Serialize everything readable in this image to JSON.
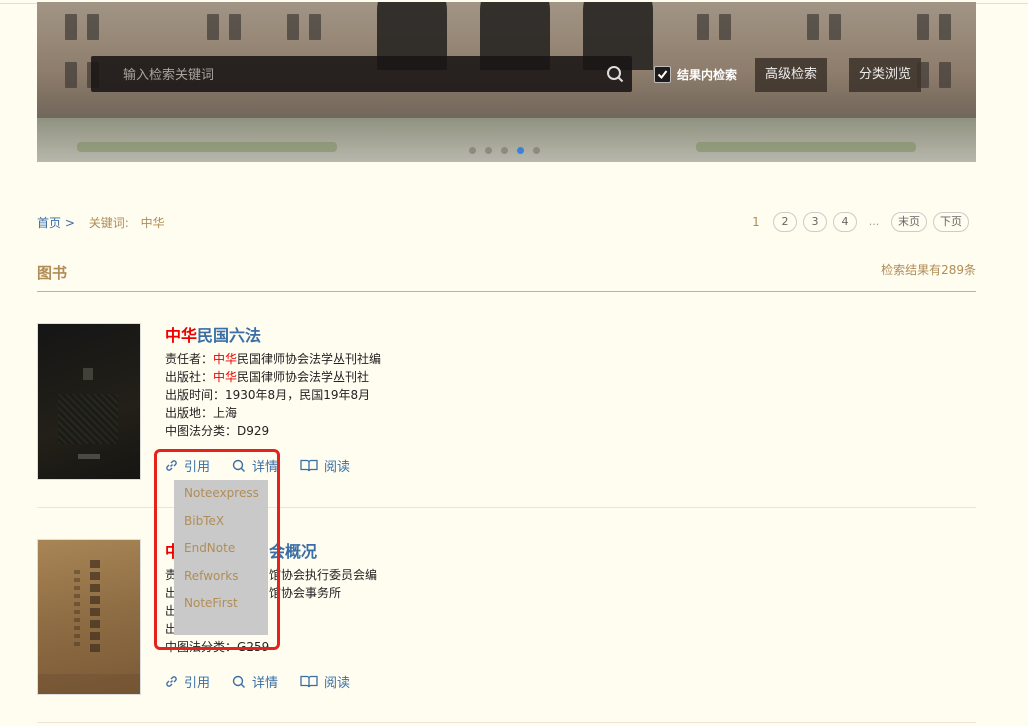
{
  "search": {
    "placeholder": "输入检索关键词",
    "within_results_label": "结果内检索",
    "within_results_checked": true,
    "advanced_label": "高级检索",
    "browse_label": "分类浏览"
  },
  "carousel": {
    "count": 5,
    "active": 3
  },
  "breadcrumb": {
    "home": "首页 >",
    "keyword_label": "关键词:",
    "keyword": "中华"
  },
  "pagination": {
    "current": "1",
    "pages": [
      "2",
      "3",
      "4"
    ],
    "ellipsis": "...",
    "last": "末页",
    "next": "下页"
  },
  "section": {
    "title": "图书",
    "result_count": "检索结果有289条"
  },
  "books": [
    {
      "title_hl": "中华",
      "title_rest": "民国六法",
      "lines": [
        {
          "label": "责任者：",
          "hl": "中华",
          "rest": "民国律师协会法学丛刊社编"
        },
        {
          "label": "出版社：",
          "hl": "中华",
          "rest": "民国律师协会法学丛刊社"
        },
        {
          "label": "出版时间：",
          "hl": "",
          "rest": "1930年8月，民国19年8月"
        },
        {
          "label": "出版地：",
          "hl": "",
          "rest": "上海"
        },
        {
          "label": "中图法分类：",
          "hl": "",
          "rest": "D929"
        }
      ]
    },
    {
      "title_hl": "中",
      "title_rest": "会概况",
      "lines": [
        {
          "label": "责",
          "hl": "",
          "rest": "馆协会执行委员会编"
        },
        {
          "label": "出",
          "hl": "",
          "rest": "馆协会事务所"
        },
        {
          "label": "出",
          "hl": "",
          "rest": ""
        },
        {
          "label": "出",
          "hl": "",
          "rest": ""
        },
        {
          "label": "中图法分类：",
          "hl": "",
          "rest": "G259"
        }
      ]
    }
  ],
  "actions": {
    "cite": "引用",
    "detail": "详情",
    "read": "阅读"
  },
  "cite_menu": [
    "Noteexpress",
    "BibTeX",
    "EndNote",
    "Refworks",
    "NoteFirst"
  ],
  "colors": {
    "accent": "#b08d57",
    "link": "#3a6ea5",
    "highlight": "#e00000",
    "annotation_box": "#e4241c"
  }
}
